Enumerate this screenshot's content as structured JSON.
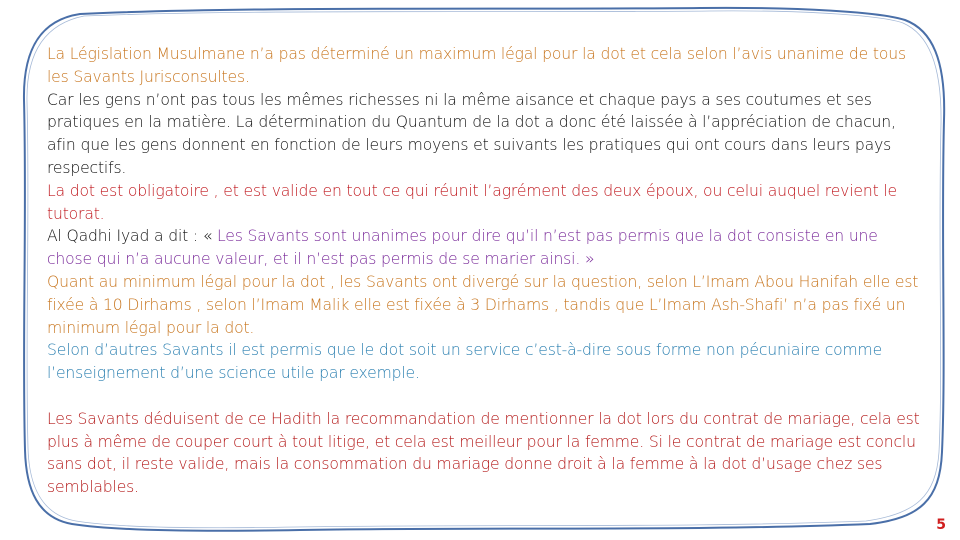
{
  "colors": {
    "frame": "#4a6fa8",
    "orange": "#c8761f",
    "black": "#111111",
    "red": "#c0191f",
    "purple": "#7a2b9a",
    "blue": "#2a7fb0",
    "page_number": "#d01f1f"
  },
  "paragraphs": {
    "p1": "La Législation Musulmane n’a pas déterminé un maximum légal pour la dot et cela selon l’avis unanime de tous les Savants Jurisconsultes.",
    "p2": "Car les gens n’ont pas tous les mêmes richesses ni la même aisance et chaque pays a ses coutumes et ses pratiques en la matière. La détermination du Quantum de la dot a donc été laissée à l’appréciation de chacun, afin que les gens donnent en fonction de leurs moyens et suivants les pratiques qui ont cours dans leurs pays respectifs.",
    "p3": "La dot est obligatoire , et est valide en tout ce qui réunit l’agrément des deux époux, ou celui auquel revient le tutorat.",
    "p4_lead": "Al Qadhi Iyad a dit : « ",
    "p4_quote": " Les Savants sont unanimes pour dire qu’il n’est pas permis que la dot consiste en une chose qui n’a aucune valeur, et il n’est pas permis de se marier ainsi. »",
    "p5": "Quant au minimum légal pour la dot , les Savants ont divergé sur la question, selon L’Imam Abou Hanifah elle est fixée à 10 Dirhams , selon l’Imam Malik elle est fixée à 3 Dirhams , tandis que L’Imam Ash-Shafi’ n’a pas fixé un minimum légal pour la dot.",
    "p6": "Selon d’autres Savants il est permis que le dot soit un service c’est-à-dire sous forme non pécuniaire comme l’enseignement d’une science utile par exemple.",
    "p7": "Les Savants déduisent de ce Hadith la recommandation de mentionner la dot lors du contrat de mariage, cela est plus à même de couper court à tout litige, et cela est meilleur pour la femme. Si le contrat de mariage est conclu sans dot, il reste valide, mais la consommation du mariage donne droit à la femme à la dot d’usage chez ses semblables."
  },
  "page_number": "5"
}
